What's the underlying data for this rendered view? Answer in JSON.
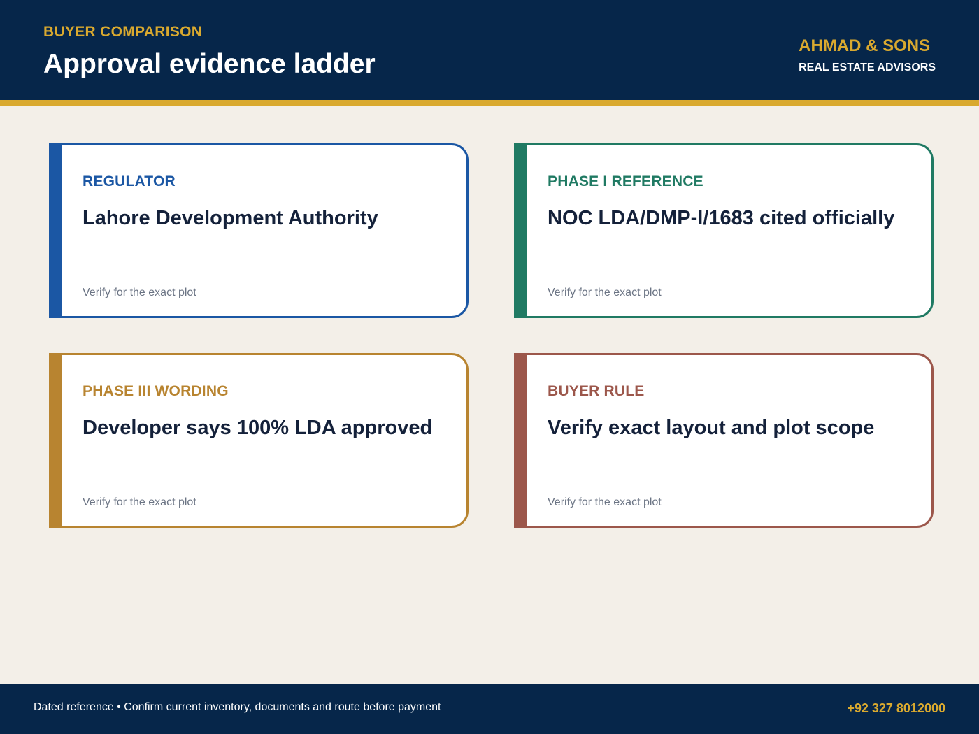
{
  "header": {
    "eyebrow": "BUYER COMPARISON",
    "title": "Approval evidence ladder",
    "brand_name": "AHMAD & SONS",
    "brand_sub": "REAL ESTATE ADVISORS"
  },
  "colors": {
    "navy": "#06264a",
    "gold": "#d9a92f",
    "background": "#f3efe8",
    "headline": "#14213a",
    "note": "#6b7484"
  },
  "cards": [
    {
      "label": "REGULATOR",
      "headline": "Lahore Development Authority",
      "note": "Verify for the exact plot",
      "color": "#1b57a4"
    },
    {
      "label": "PHASE I REFERENCE",
      "headline": "NOC LDA/DMP-I/1683 cited officially",
      "note": "Verify for the exact plot",
      "color": "#207a63"
    },
    {
      "label": "PHASE III WORDING",
      "headline": "Developer says 100% LDA approved",
      "note": "Verify for the exact plot",
      "color": "#b88430"
    },
    {
      "label": "BUYER RULE",
      "headline": "Verify exact layout and plot scope",
      "note": "Verify for the exact plot",
      "color": "#9c574b"
    }
  ],
  "footer": {
    "text": "Dated reference • Confirm current inventory, documents and route before payment",
    "phone": "+92 327 8012000"
  }
}
